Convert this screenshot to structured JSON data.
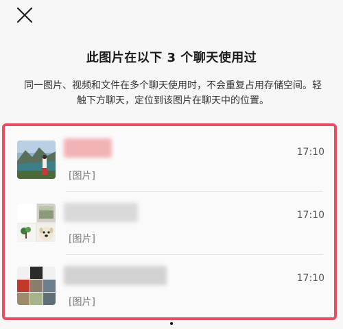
{
  "header": {
    "close_icon": "close-icon",
    "title": "此图片在以下 3 个聊天使用过",
    "description": "同一图片、视频和文件在多个聊天使用时，不会重复占用存储空间。轻触下方聊天，定位到该图片在聊天中的位置。"
  },
  "chats": [
    {
      "time": "17:10",
      "preview": "[图片]"
    },
    {
      "time": "17:10",
      "preview": "[图片]"
    },
    {
      "time": "17:10",
      "preview": "[图片]"
    }
  ],
  "colors": {
    "highlight_border": "#e84e62"
  }
}
